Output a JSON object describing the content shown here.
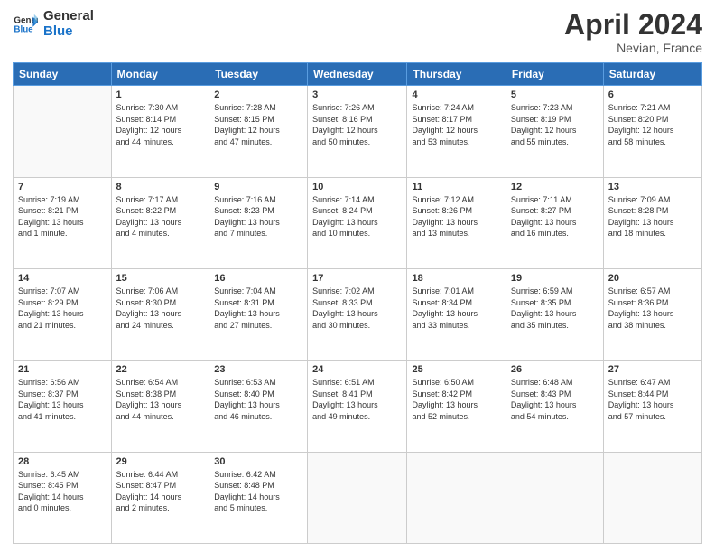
{
  "header": {
    "logo_line1": "General",
    "logo_line2": "Blue",
    "month_year": "April 2024",
    "location": "Nevian, France"
  },
  "weekdays": [
    "Sunday",
    "Monday",
    "Tuesday",
    "Wednesday",
    "Thursday",
    "Friday",
    "Saturday"
  ],
  "weeks": [
    [
      {
        "day": "",
        "info": ""
      },
      {
        "day": "1",
        "info": "Sunrise: 7:30 AM\nSunset: 8:14 PM\nDaylight: 12 hours\nand 44 minutes."
      },
      {
        "day": "2",
        "info": "Sunrise: 7:28 AM\nSunset: 8:15 PM\nDaylight: 12 hours\nand 47 minutes."
      },
      {
        "day": "3",
        "info": "Sunrise: 7:26 AM\nSunset: 8:16 PM\nDaylight: 12 hours\nand 50 minutes."
      },
      {
        "day": "4",
        "info": "Sunrise: 7:24 AM\nSunset: 8:17 PM\nDaylight: 12 hours\nand 53 minutes."
      },
      {
        "day": "5",
        "info": "Sunrise: 7:23 AM\nSunset: 8:19 PM\nDaylight: 12 hours\nand 55 minutes."
      },
      {
        "day": "6",
        "info": "Sunrise: 7:21 AM\nSunset: 8:20 PM\nDaylight: 12 hours\nand 58 minutes."
      }
    ],
    [
      {
        "day": "7",
        "info": "Sunrise: 7:19 AM\nSunset: 8:21 PM\nDaylight: 13 hours\nand 1 minute."
      },
      {
        "day": "8",
        "info": "Sunrise: 7:17 AM\nSunset: 8:22 PM\nDaylight: 13 hours\nand 4 minutes."
      },
      {
        "day": "9",
        "info": "Sunrise: 7:16 AM\nSunset: 8:23 PM\nDaylight: 13 hours\nand 7 minutes."
      },
      {
        "day": "10",
        "info": "Sunrise: 7:14 AM\nSunset: 8:24 PM\nDaylight: 13 hours\nand 10 minutes."
      },
      {
        "day": "11",
        "info": "Sunrise: 7:12 AM\nSunset: 8:26 PM\nDaylight: 13 hours\nand 13 minutes."
      },
      {
        "day": "12",
        "info": "Sunrise: 7:11 AM\nSunset: 8:27 PM\nDaylight: 13 hours\nand 16 minutes."
      },
      {
        "day": "13",
        "info": "Sunrise: 7:09 AM\nSunset: 8:28 PM\nDaylight: 13 hours\nand 18 minutes."
      }
    ],
    [
      {
        "day": "14",
        "info": "Sunrise: 7:07 AM\nSunset: 8:29 PM\nDaylight: 13 hours\nand 21 minutes."
      },
      {
        "day": "15",
        "info": "Sunrise: 7:06 AM\nSunset: 8:30 PM\nDaylight: 13 hours\nand 24 minutes."
      },
      {
        "day": "16",
        "info": "Sunrise: 7:04 AM\nSunset: 8:31 PM\nDaylight: 13 hours\nand 27 minutes."
      },
      {
        "day": "17",
        "info": "Sunrise: 7:02 AM\nSunset: 8:33 PM\nDaylight: 13 hours\nand 30 minutes."
      },
      {
        "day": "18",
        "info": "Sunrise: 7:01 AM\nSunset: 8:34 PM\nDaylight: 13 hours\nand 33 minutes."
      },
      {
        "day": "19",
        "info": "Sunrise: 6:59 AM\nSunset: 8:35 PM\nDaylight: 13 hours\nand 35 minutes."
      },
      {
        "day": "20",
        "info": "Sunrise: 6:57 AM\nSunset: 8:36 PM\nDaylight: 13 hours\nand 38 minutes."
      }
    ],
    [
      {
        "day": "21",
        "info": "Sunrise: 6:56 AM\nSunset: 8:37 PM\nDaylight: 13 hours\nand 41 minutes."
      },
      {
        "day": "22",
        "info": "Sunrise: 6:54 AM\nSunset: 8:38 PM\nDaylight: 13 hours\nand 44 minutes."
      },
      {
        "day": "23",
        "info": "Sunrise: 6:53 AM\nSunset: 8:40 PM\nDaylight: 13 hours\nand 46 minutes."
      },
      {
        "day": "24",
        "info": "Sunrise: 6:51 AM\nSunset: 8:41 PM\nDaylight: 13 hours\nand 49 minutes."
      },
      {
        "day": "25",
        "info": "Sunrise: 6:50 AM\nSunset: 8:42 PM\nDaylight: 13 hours\nand 52 minutes."
      },
      {
        "day": "26",
        "info": "Sunrise: 6:48 AM\nSunset: 8:43 PM\nDaylight: 13 hours\nand 54 minutes."
      },
      {
        "day": "27",
        "info": "Sunrise: 6:47 AM\nSunset: 8:44 PM\nDaylight: 13 hours\nand 57 minutes."
      }
    ],
    [
      {
        "day": "28",
        "info": "Sunrise: 6:45 AM\nSunset: 8:45 PM\nDaylight: 14 hours\nand 0 minutes."
      },
      {
        "day": "29",
        "info": "Sunrise: 6:44 AM\nSunset: 8:47 PM\nDaylight: 14 hours\nand 2 minutes."
      },
      {
        "day": "30",
        "info": "Sunrise: 6:42 AM\nSunset: 8:48 PM\nDaylight: 14 hours\nand 5 minutes."
      },
      {
        "day": "",
        "info": ""
      },
      {
        "day": "",
        "info": ""
      },
      {
        "day": "",
        "info": ""
      },
      {
        "day": "",
        "info": ""
      }
    ]
  ]
}
